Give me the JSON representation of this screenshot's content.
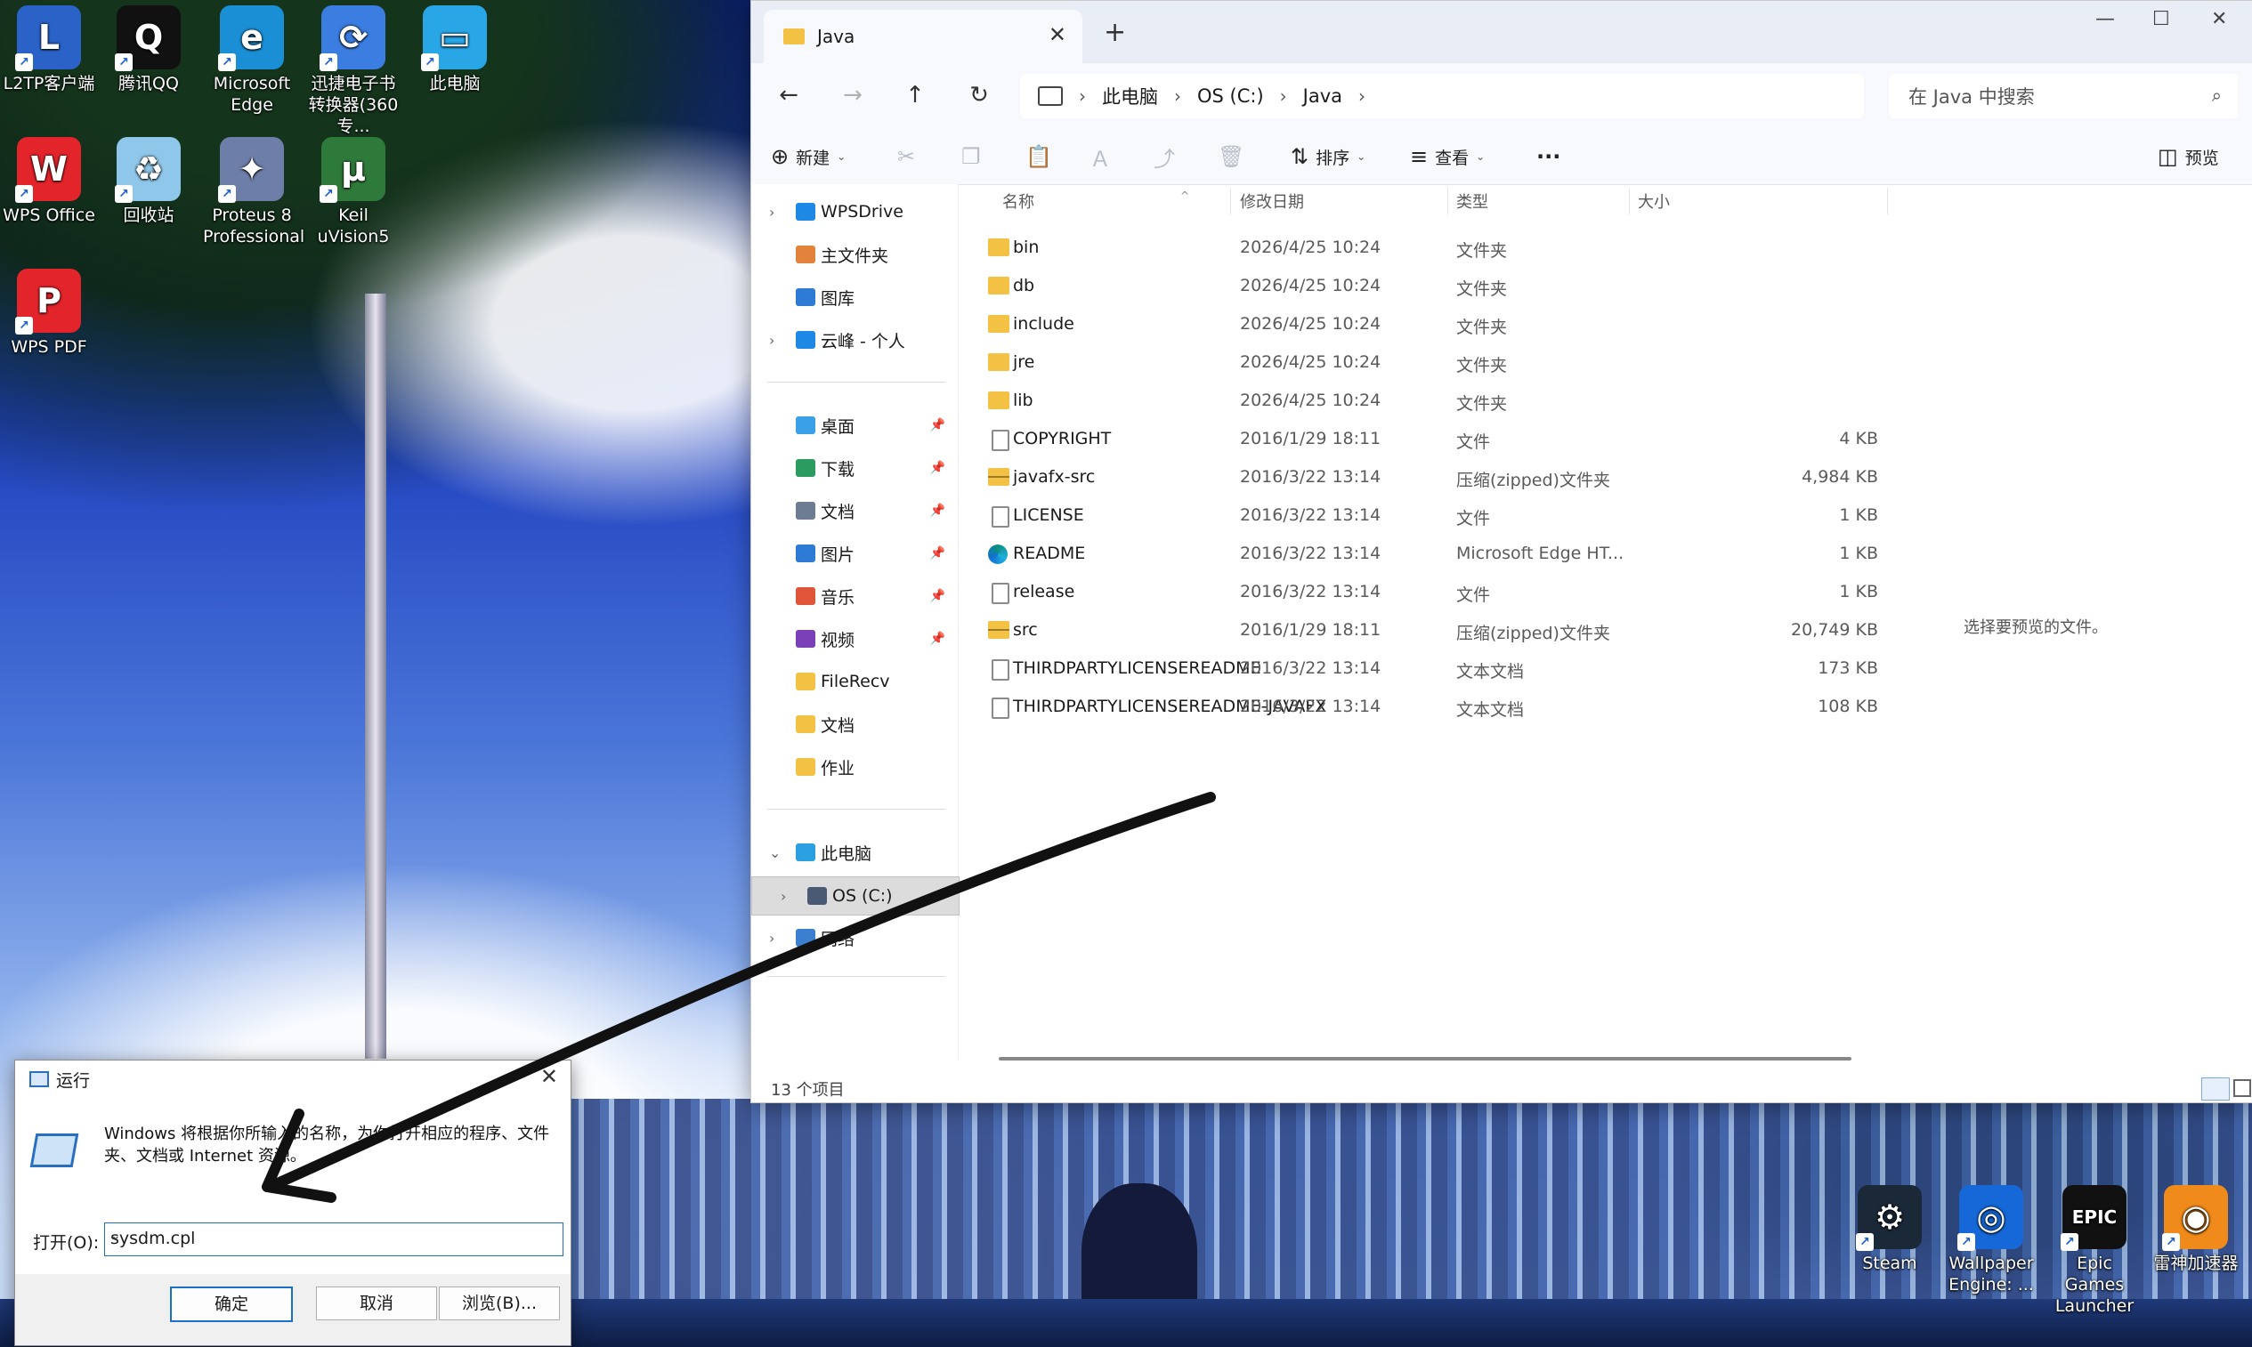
{
  "desktop": {
    "icons": [
      {
        "label": "L2TP客户端",
        "glyph": "L",
        "color": "#2a62c8"
      },
      {
        "label": "腾讯QQ",
        "glyph": "Q",
        "color": "#111111"
      },
      {
        "label": "Microsoft Edge",
        "glyph": "e",
        "color": "#1a8fd6"
      },
      {
        "label": "迅捷电子书转换器(360专...",
        "glyph": "⟳",
        "color": "#3b7de0"
      },
      {
        "label": "此电脑",
        "glyph": "▭",
        "color": "#28a6e6"
      },
      {
        "label": "WPS Office",
        "glyph": "W",
        "color": "#e3242b"
      },
      {
        "label": "回收站",
        "glyph": "♻",
        "color": "#8ec7ea"
      },
      {
        "label": "Proteus 8 Professional",
        "glyph": "✦",
        "color": "#6d7ea8"
      },
      {
        "label": "Keil uVision5",
        "glyph": "μ",
        "color": "#2e7a3a"
      },
      {
        "label": "WPS PDF",
        "glyph": "P",
        "color": "#e3242b"
      },
      {
        "label": "Steam",
        "glyph": "⚙",
        "color": "#1b2838"
      },
      {
        "label": "Wallpaper Engine: ...",
        "glyph": "◎",
        "color": "#1668d8"
      },
      {
        "label": "Epic Games Launcher",
        "glyph": "EPIC",
        "color": "#111111"
      },
      {
        "label": "雷神加速器",
        "glyph": "◉",
        "color": "#f08a1a"
      }
    ]
  },
  "explorer": {
    "tab_title": "Java",
    "new_tab": "+",
    "window_controls": {
      "minimize": "—",
      "maximize": "☐",
      "close": "✕"
    },
    "nav": {
      "back": "←",
      "forward": "→",
      "up": "↑",
      "refresh": "↻"
    },
    "breadcrumb": [
      "此电脑",
      "OS (C:)",
      "Java"
    ],
    "search_placeholder": "在 Java 中搜索",
    "toolbar": {
      "new": "新建",
      "sort": "排序",
      "view": "查看",
      "more": "···",
      "preview": "预览",
      "icons": {
        "cut": "✂",
        "copy": "❐",
        "paste": "📋",
        "rename": "Ａ",
        "share": "⤴",
        "delete": "🗑"
      }
    },
    "sidebar": [
      {
        "label": "WPSDrive",
        "arrow": "›",
        "color": "#1e88e5",
        "pin": ""
      },
      {
        "label": "主文件夹",
        "arrow": "",
        "color": "#e3823a",
        "pin": ""
      },
      {
        "label": "图库",
        "arrow": "",
        "color": "#2e7bd6",
        "pin": ""
      },
      {
        "label": "云峰 - 个人",
        "arrow": "›",
        "color": "#1e88e5",
        "pin": ""
      },
      {
        "label": "桌面",
        "arrow": "",
        "color": "#3aa0e8",
        "pin": "📌"
      },
      {
        "label": "下载",
        "arrow": "",
        "color": "#2b9b5f",
        "pin": "📌"
      },
      {
        "label": "文档",
        "arrow": "",
        "color": "#6d7c92",
        "pin": "📌"
      },
      {
        "label": "图片",
        "arrow": "",
        "color": "#2e7bd6",
        "pin": "📌"
      },
      {
        "label": "音乐",
        "arrow": "",
        "color": "#e0553a",
        "pin": "📌"
      },
      {
        "label": "视频",
        "arrow": "",
        "color": "#7b3fb8",
        "pin": "📌"
      },
      {
        "label": "FileRecv",
        "arrow": "",
        "color": "#f3c244",
        "pin": ""
      },
      {
        "label": "文档",
        "arrow": "",
        "color": "#f3c244",
        "pin": ""
      },
      {
        "label": "作业",
        "arrow": "",
        "color": "#f3c244",
        "pin": ""
      },
      {
        "label": "此电脑",
        "arrow": "⌄",
        "color": "#2aa0e0",
        "pin": ""
      },
      {
        "label": "OS (C:)",
        "arrow": "›",
        "color": "#4a5a74",
        "pin": ""
      },
      {
        "label": "网络",
        "arrow": "›",
        "color": "#3a7fd0",
        "pin": ""
      }
    ],
    "columns": {
      "name": "名称",
      "date": "修改日期",
      "type": "类型",
      "size": "大小"
    },
    "files": [
      {
        "name": "bin",
        "date": "2026/4/25 10:24",
        "type": "文件夹",
        "size": "",
        "kind": "folder"
      },
      {
        "name": "db",
        "date": "2026/4/25 10:24",
        "type": "文件夹",
        "size": "",
        "kind": "folder"
      },
      {
        "name": "include",
        "date": "2026/4/25 10:24",
        "type": "文件夹",
        "size": "",
        "kind": "folder"
      },
      {
        "name": "jre",
        "date": "2026/4/25 10:24",
        "type": "文件夹",
        "size": "",
        "kind": "folder"
      },
      {
        "name": "lib",
        "date": "2026/4/25 10:24",
        "type": "文件夹",
        "size": "",
        "kind": "folder"
      },
      {
        "name": "COPYRIGHT",
        "date": "2016/1/29 18:11",
        "type": "文件",
        "size": "4 KB",
        "kind": "file"
      },
      {
        "name": "javafx-src",
        "date": "2016/3/22 13:14",
        "type": "压缩(zipped)文件夹",
        "size": "4,984 KB",
        "kind": "zip"
      },
      {
        "name": "LICENSE",
        "date": "2016/3/22 13:14",
        "type": "文件",
        "size": "1 KB",
        "kind": "file"
      },
      {
        "name": "README",
        "date": "2016/3/22 13:14",
        "type": "Microsoft Edge HT...",
        "size": "1 KB",
        "kind": "edge"
      },
      {
        "name": "release",
        "date": "2016/3/22 13:14",
        "type": "文件",
        "size": "1 KB",
        "kind": "file"
      },
      {
        "name": "src",
        "date": "2016/1/29 18:11",
        "type": "压缩(zipped)文件夹",
        "size": "20,749 KB",
        "kind": "zip"
      },
      {
        "name": "THIRDPARTYLICENSEREADME",
        "date": "2016/3/22 13:14",
        "type": "文本文档",
        "size": "173 KB",
        "kind": "file"
      },
      {
        "name": "THIRDPARTYLICENSEREADME-JAVAFX",
        "date": "2016/3/22 13:14",
        "type": "文本文档",
        "size": "108 KB",
        "kind": "file"
      }
    ],
    "preview_text": "选择要预览的文件。",
    "status": "13 个项目"
  },
  "run_dialog": {
    "title": "运行",
    "close": "✕",
    "description": "Windows 将根据你所输入的名称，为你打开相应的程序、文件夹、文档或 Internet 资源。",
    "open_label": "打开(O):",
    "value": "sysdm.cpl",
    "ok": "确定",
    "cancel": "取消",
    "browse": "浏览(B)..."
  },
  "annotation": {
    "color": "#111111"
  }
}
